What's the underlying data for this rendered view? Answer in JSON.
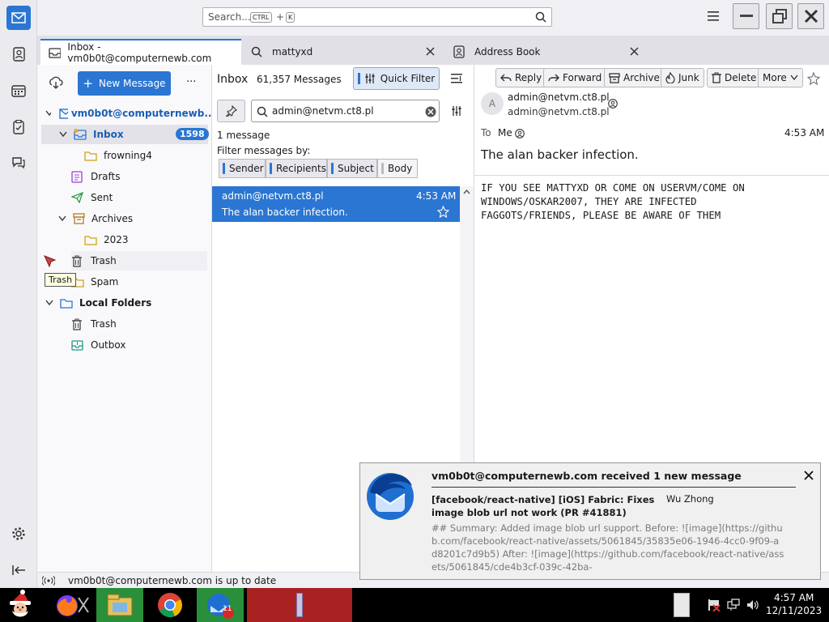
{
  "search": {
    "placeholder": "Search...",
    "key1": "CTRL",
    "plus": "+",
    "key2": "K"
  },
  "tabs": [
    {
      "label": "Inbox - vm0b0t@computernewb.com"
    },
    {
      "label": "mattyxd"
    },
    {
      "label": "Address Book"
    }
  ],
  "folders": {
    "new_message": "New Message",
    "more": "···",
    "account": "vm0b0t@computernewb...",
    "inbox": "Inbox",
    "inbox_count": "1598",
    "frowning": "frowning4",
    "drafts": "Drafts",
    "sent": "Sent",
    "archives": "Archives",
    "year": "2023",
    "trash": "Trash",
    "spam": "Spam",
    "local": "Local Folders",
    "local_trash": "Trash",
    "outbox": "Outbox",
    "tooltip": "Trash"
  },
  "thread": {
    "folder": "Inbox",
    "count": "61,357 Messages",
    "quick_filter": "Quick Filter",
    "filter_value": "admin@netvm.ct8.pl",
    "result_count": "1 message",
    "filter_by": "Filter messages by:",
    "chips": [
      "Sender",
      "Recipients",
      "Subject",
      "Body"
    ],
    "message": {
      "from": "admin@netvm.ct8.pl",
      "time": "4:53 AM",
      "subject": "The alan backer infection."
    }
  },
  "message": {
    "actions": [
      "Reply",
      "Forward",
      "Archive",
      "Junk",
      "Delete",
      "More"
    ],
    "avatar": "A",
    "from_name": "admin@netvm.ct8.pl",
    "from_addr": "admin@netvm.ct8.pl",
    "to_label": "To",
    "to_value": "Me",
    "time": "4:53 AM",
    "subject": "The alan backer infection.",
    "body": "IF YOU SEE MATTYXD OR COME ON USERVM/COME ON\nWINDOWS/OSKAR2007, THEY ARE INFECTED\nFAGGOTS/FRIENDS, PLEASE BE AWARE OF THEM"
  },
  "status": "vm0b0t@computernewb.com is up to date",
  "notification": {
    "title": "vm0b0t@computernewb.com received 1 new message",
    "subject": "[facebook/react-native] [iOS] Fabric: Fixes image blob url not work (PR #41881)",
    "sender": "Wu Zhong",
    "preview": "## Summary: Added image blob url support. Before: ![image](https://github.com/facebook/react-native/assets/5061845/35835e06-1946-4cc0-9f09-ad8201c7d9b5) After: ![image](https://github.com/facebook/react-native/assets/5061845/cde4b3cf-039c-42ba-"
  },
  "taskbar": {
    "time": "4:57 AM",
    "date": "12/11/2023",
    "badge": "11"
  },
  "colors": {
    "accent": "#2a76d2",
    "selected": "#2a76d2",
    "red_tile": "#c62828"
  }
}
